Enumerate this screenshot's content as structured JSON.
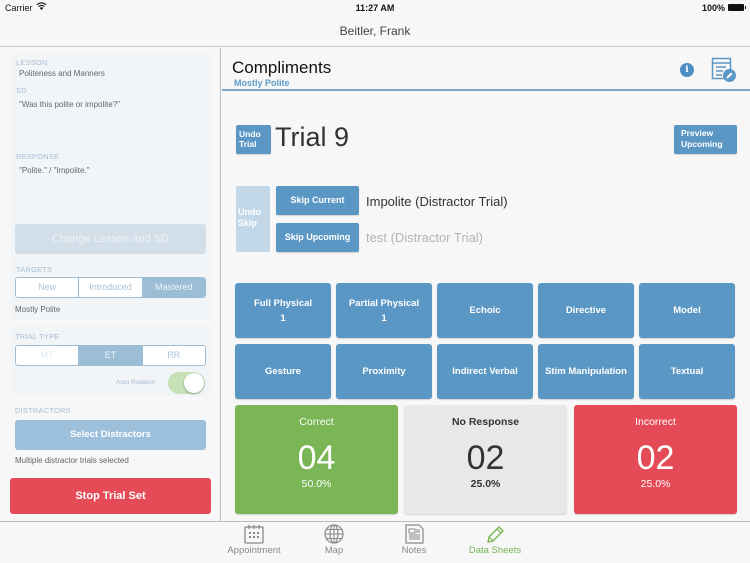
{
  "status_bar": {
    "carrier": "Carrier",
    "wifi_icon": "wifi-icon",
    "time": "11:27 AM",
    "battery": "100%"
  },
  "nav": {
    "title": "Beitler, Frank"
  },
  "sidebar": {
    "lesson_label": "LESSON",
    "lesson_value": "Politeness and Manners",
    "sd_label": "SD",
    "sd_value": "\"Was this polite or impolite?\"",
    "response_label": "RESPONSE",
    "response_value": "\"Polite.\" / \"Impolite.\"",
    "change_button": "Change Lesson and SD",
    "targets_label": "TARGETS",
    "targets": [
      {
        "label": "New",
        "active": false
      },
      {
        "label": "Introduced",
        "active": false
      },
      {
        "label": "Mastered",
        "active": true
      }
    ],
    "target_selected": "Mostly Polite",
    "trial_type_label": "TRIAL TYPE",
    "trial_types": [
      {
        "label": "MT",
        "active": false
      },
      {
        "label": "ET",
        "active": true
      },
      {
        "label": "RR",
        "active": false
      }
    ],
    "auto_rotation_label": "Auto Rotation",
    "auto_rotation_on": true,
    "distractors_label": "DISTRACTORS",
    "select_distractors_button": "Select Distractors",
    "distractors_note": "Multiple distractor trials selected",
    "stop_button": "Stop Trial Set"
  },
  "main": {
    "title": "Compliments",
    "subtitle": "Mostly Polite",
    "info_icon": "i",
    "undo_trial_line1": "Undo",
    "undo_trial_line2": "Trial",
    "trial_label": "Trial 9",
    "preview_line1": "Preview",
    "preview_line2": "Upcoming",
    "undo_skip_line1": "Undo",
    "undo_skip_line2": "Skip",
    "skip_current_button": "Skip Current",
    "skip_current_text": "Impolite (Distractor Trial)",
    "skip_upcoming_button": "Skip Upcoming",
    "skip_upcoming_text": "test (Distractor Trial)",
    "prompts": [
      {
        "label": "Full Physical",
        "count": "1"
      },
      {
        "label": "Partial Physical",
        "count": "1"
      },
      {
        "label": "Echoic",
        "count": ""
      },
      {
        "label": "Directive",
        "count": ""
      },
      {
        "label": "Model",
        "count": ""
      },
      {
        "label": "Gesture",
        "count": ""
      },
      {
        "label": "Proximity",
        "count": ""
      },
      {
        "label": "Indirect Verbal",
        "count": ""
      },
      {
        "label": "Stim Manipulation",
        "count": ""
      },
      {
        "label": "Textual",
        "count": ""
      }
    ],
    "scores": {
      "correct": {
        "label": "Correct",
        "count": "04",
        "percent": "50.0%"
      },
      "no_response": {
        "label": "No Response",
        "count": "02",
        "percent": "25.0%"
      },
      "incorrect": {
        "label": "Incorrect",
        "count": "02",
        "percent": "25.0%"
      }
    }
  },
  "tabs": [
    {
      "label": "Appointment",
      "icon": "calendar-icon",
      "active": false
    },
    {
      "label": "Map",
      "icon": "globe-icon",
      "active": false
    },
    {
      "label": "Notes",
      "icon": "notes-icon",
      "active": false
    },
    {
      "label": "Data Sheets",
      "icon": "pencil-icon",
      "active": true
    }
  ],
  "colors": {
    "accent_blue": "#5b97c5",
    "correct_green": "#7ab655",
    "incorrect_red": "#e54b57",
    "no_response_gray": "#e8e8e8",
    "active_tab_green": "#76b551"
  }
}
